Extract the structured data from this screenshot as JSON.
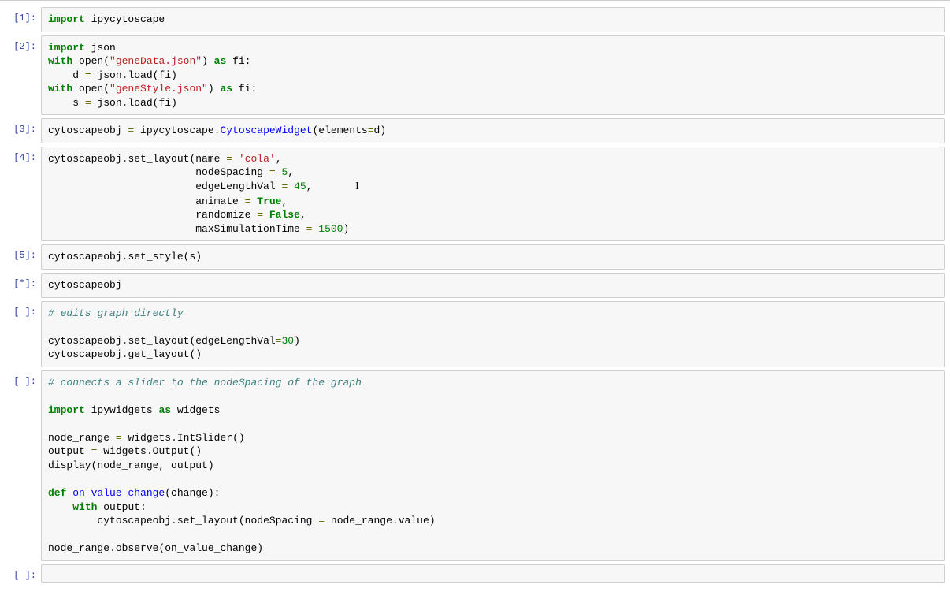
{
  "cells": [
    {
      "prompt": "[1]:"
    },
    {
      "prompt": "[2]:"
    },
    {
      "prompt": "[3]:"
    },
    {
      "prompt": "[4]:"
    },
    {
      "prompt": "[5]:"
    },
    {
      "prompt": "[*]:"
    },
    {
      "prompt": "[ ]:"
    },
    {
      "prompt": "[ ]:"
    },
    {
      "prompt": "[ ]:"
    }
  ],
  "code": {
    "c1": {
      "l1a": "import",
      "l1b": " ipycytoscape"
    },
    "c2": {
      "l1a": "import",
      "l1b": " json",
      "l2a": "with",
      "l2b": " open(",
      "l2c": "\"geneData.json\"",
      "l2d": ") ",
      "l2e": "as",
      "l2f": " fi:",
      "l3a": "    d ",
      "l3b": "=",
      "l3c": " json",
      "l3d": ".",
      "l3e": "load",
      "l3f": "(fi)",
      "l4a": "with",
      "l4b": " open(",
      "l4c": "\"geneStyle.json\"",
      "l4d": ") ",
      "l4e": "as",
      "l4f": " fi:",
      "l5a": "    s ",
      "l5b": "=",
      "l5c": " json",
      "l5d": ".",
      "l5e": "load",
      "l5f": "(fi)"
    },
    "c3": {
      "a": "cytoscapeobj ",
      "b": "=",
      "c": " ipycytoscape",
      "d": ".",
      "e": "CytoscapeWidget",
      "f": "(elements",
      "g": "=",
      "h": "d",
      "i": ")"
    },
    "c4": {
      "l1a": "cytoscapeobj",
      "l1b": ".",
      "l1c": "set_layout",
      "l1d": "(name ",
      "l1e": "=",
      "l1f": " ",
      "l1g": "'cola'",
      "l1h": ",",
      "l2a": "                        nodeSpacing ",
      "l2b": "=",
      "l2c": " ",
      "l2d": "5",
      "l2e": ",",
      "l3a": "                        edgeLengthVal ",
      "l3b": "=",
      "l3c": " ",
      "l3d": "45",
      "l3e": ",",
      "caret": "I",
      "l4a": "                        animate ",
      "l4b": "=",
      "l4c": " ",
      "l4d": "True",
      "l4e": ",",
      "l5a": "                        randomize ",
      "l5b": "=",
      "l5c": " ",
      "l5d": "False",
      "l5e": ",",
      "l6a": "                        maxSimulationTime ",
      "l6b": "=",
      "l6c": " ",
      "l6d": "1500",
      "l6e": ")"
    },
    "c5": {
      "a": "cytoscapeobj",
      "b": ".",
      "c": "set_style",
      "d": "(s)"
    },
    "c6": {
      "a": "cytoscapeobj"
    },
    "c7": {
      "l1": "# edits graph directly",
      "bl": "",
      "l2a": "cytoscapeobj",
      "l2b": ".",
      "l2c": "set_layout",
      "l2d": "(edgeLengthVal",
      "l2e": "=",
      "l2f": "30",
      "l2g": ")",
      "l3a": "cytoscapeobj",
      "l3b": ".",
      "l3c": "get_layout",
      "l3d": "()"
    },
    "c8": {
      "l1": "# connects a slider to the nodeSpacing of the graph",
      "l2a": "import",
      "l2b": " ipywidgets ",
      "l2c": "as",
      "l2d": " widgets",
      "l3a": "node_range ",
      "l3b": "=",
      "l3c": " widgets",
      "l3d": ".",
      "l3e": "IntSlider",
      "l3f": "()",
      "l4a": "output ",
      "l4b": "=",
      "l4c": " widgets",
      "l4d": ".",
      "l4e": "Output",
      "l4f": "()",
      "l5a": "display(node_range, output)",
      "l6a": "def",
      "l6b": " ",
      "l6c": "on_value_change",
      "l6d": "(change):",
      "l7a": "    ",
      "l7b": "with",
      "l7c": " output:",
      "l8a": "        cytoscapeobj",
      "l8b": ".",
      "l8c": "set_layout",
      "l8d": "(nodeSpacing ",
      "l8e": "=",
      "l8f": " node_range",
      "l8g": ".",
      "l8h": "value",
      "l8i": ")",
      "l9a": "node_range",
      "l9b": ".",
      "l9c": "observe",
      "l9d": "(on_value_change)"
    },
    "c9": {
      "a": ""
    }
  }
}
